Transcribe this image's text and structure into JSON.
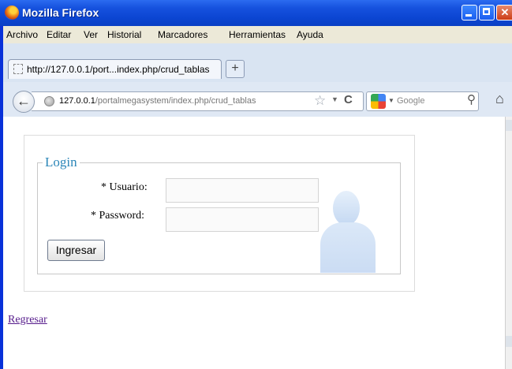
{
  "window": {
    "title": "Mozilla Firefox"
  },
  "menu": {
    "items": [
      {
        "label": "Archivo"
      },
      {
        "label": "Editar"
      },
      {
        "label": "Ver"
      },
      {
        "label": "Historial"
      },
      {
        "label": "Marcadores"
      },
      {
        "label": "Herramientas"
      },
      {
        "label": "Ayuda"
      }
    ]
  },
  "tabs": {
    "active_label": "http://127.0.0.1/port...index.php/crud_tablas",
    "new_tab_symbol": "+"
  },
  "nav": {
    "url_host": "127.0.0.1",
    "url_path": "/portalmegasystem/index.php/crud_tablas",
    "search_placeholder": "Google"
  },
  "login": {
    "legend": "Login",
    "user_label": "* Usuario:",
    "password_label": "* Password:",
    "user_value": "",
    "password_value": "",
    "submit_label": "Ingresar"
  },
  "page": {
    "back_link": "Regresar"
  },
  "icons": {
    "logo": "firefox-logo",
    "back": "back-arrow-icon",
    "globe": "globe-icon",
    "star": "star-icon",
    "reload": "reload-icon",
    "google": "google-icon",
    "search": "magnifier-icon",
    "home": "home-icon",
    "avatar": "user-avatar-icon"
  },
  "colors": {
    "titlebar": "#0b45d2",
    "legend": "#2b86b8",
    "link": "#551a8b"
  }
}
